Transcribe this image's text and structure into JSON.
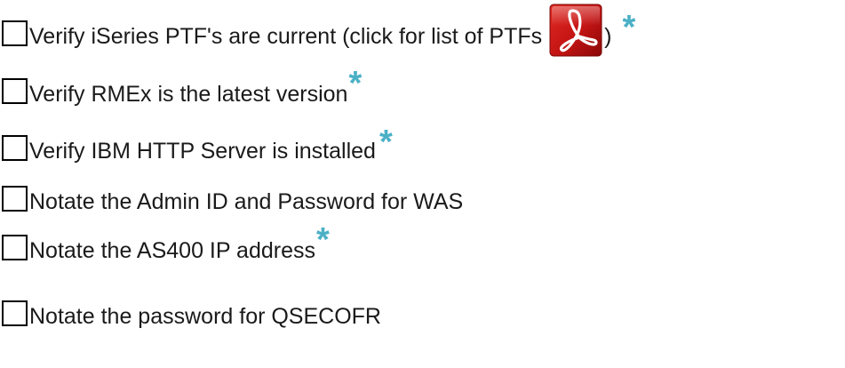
{
  "colors": {
    "asterisk": "#4bb0c6",
    "checkbox_border": "#000000",
    "text": "#1a1a1a",
    "pdf_red_dark": "#9c0a0a",
    "pdf_red_light": "#e12a22"
  },
  "icons": {
    "pdf": "adobe-pdf-icon",
    "checkbox": "empty-checkbox"
  },
  "items": [
    {
      "label": "Verify iSeries PTF's are current  (click for list of PTFs ",
      "suffix": ")",
      "has_pdf_link": true,
      "required": true,
      "required_mark": "*"
    },
    {
      "label": "Verify RMEx is the latest version",
      "required": true,
      "required_mark": "*"
    },
    {
      "label": "Verify IBM HTTP Server is installed ",
      "required": true,
      "required_mark": "*"
    },
    {
      "label": "Notate the Admin ID and Password for WAS",
      "required": false
    },
    {
      "label": "Notate the  AS400 IP address",
      "required": true,
      "required_mark": "*"
    },
    {
      "label": "Notate the password for QSECOFR",
      "required": false
    }
  ]
}
